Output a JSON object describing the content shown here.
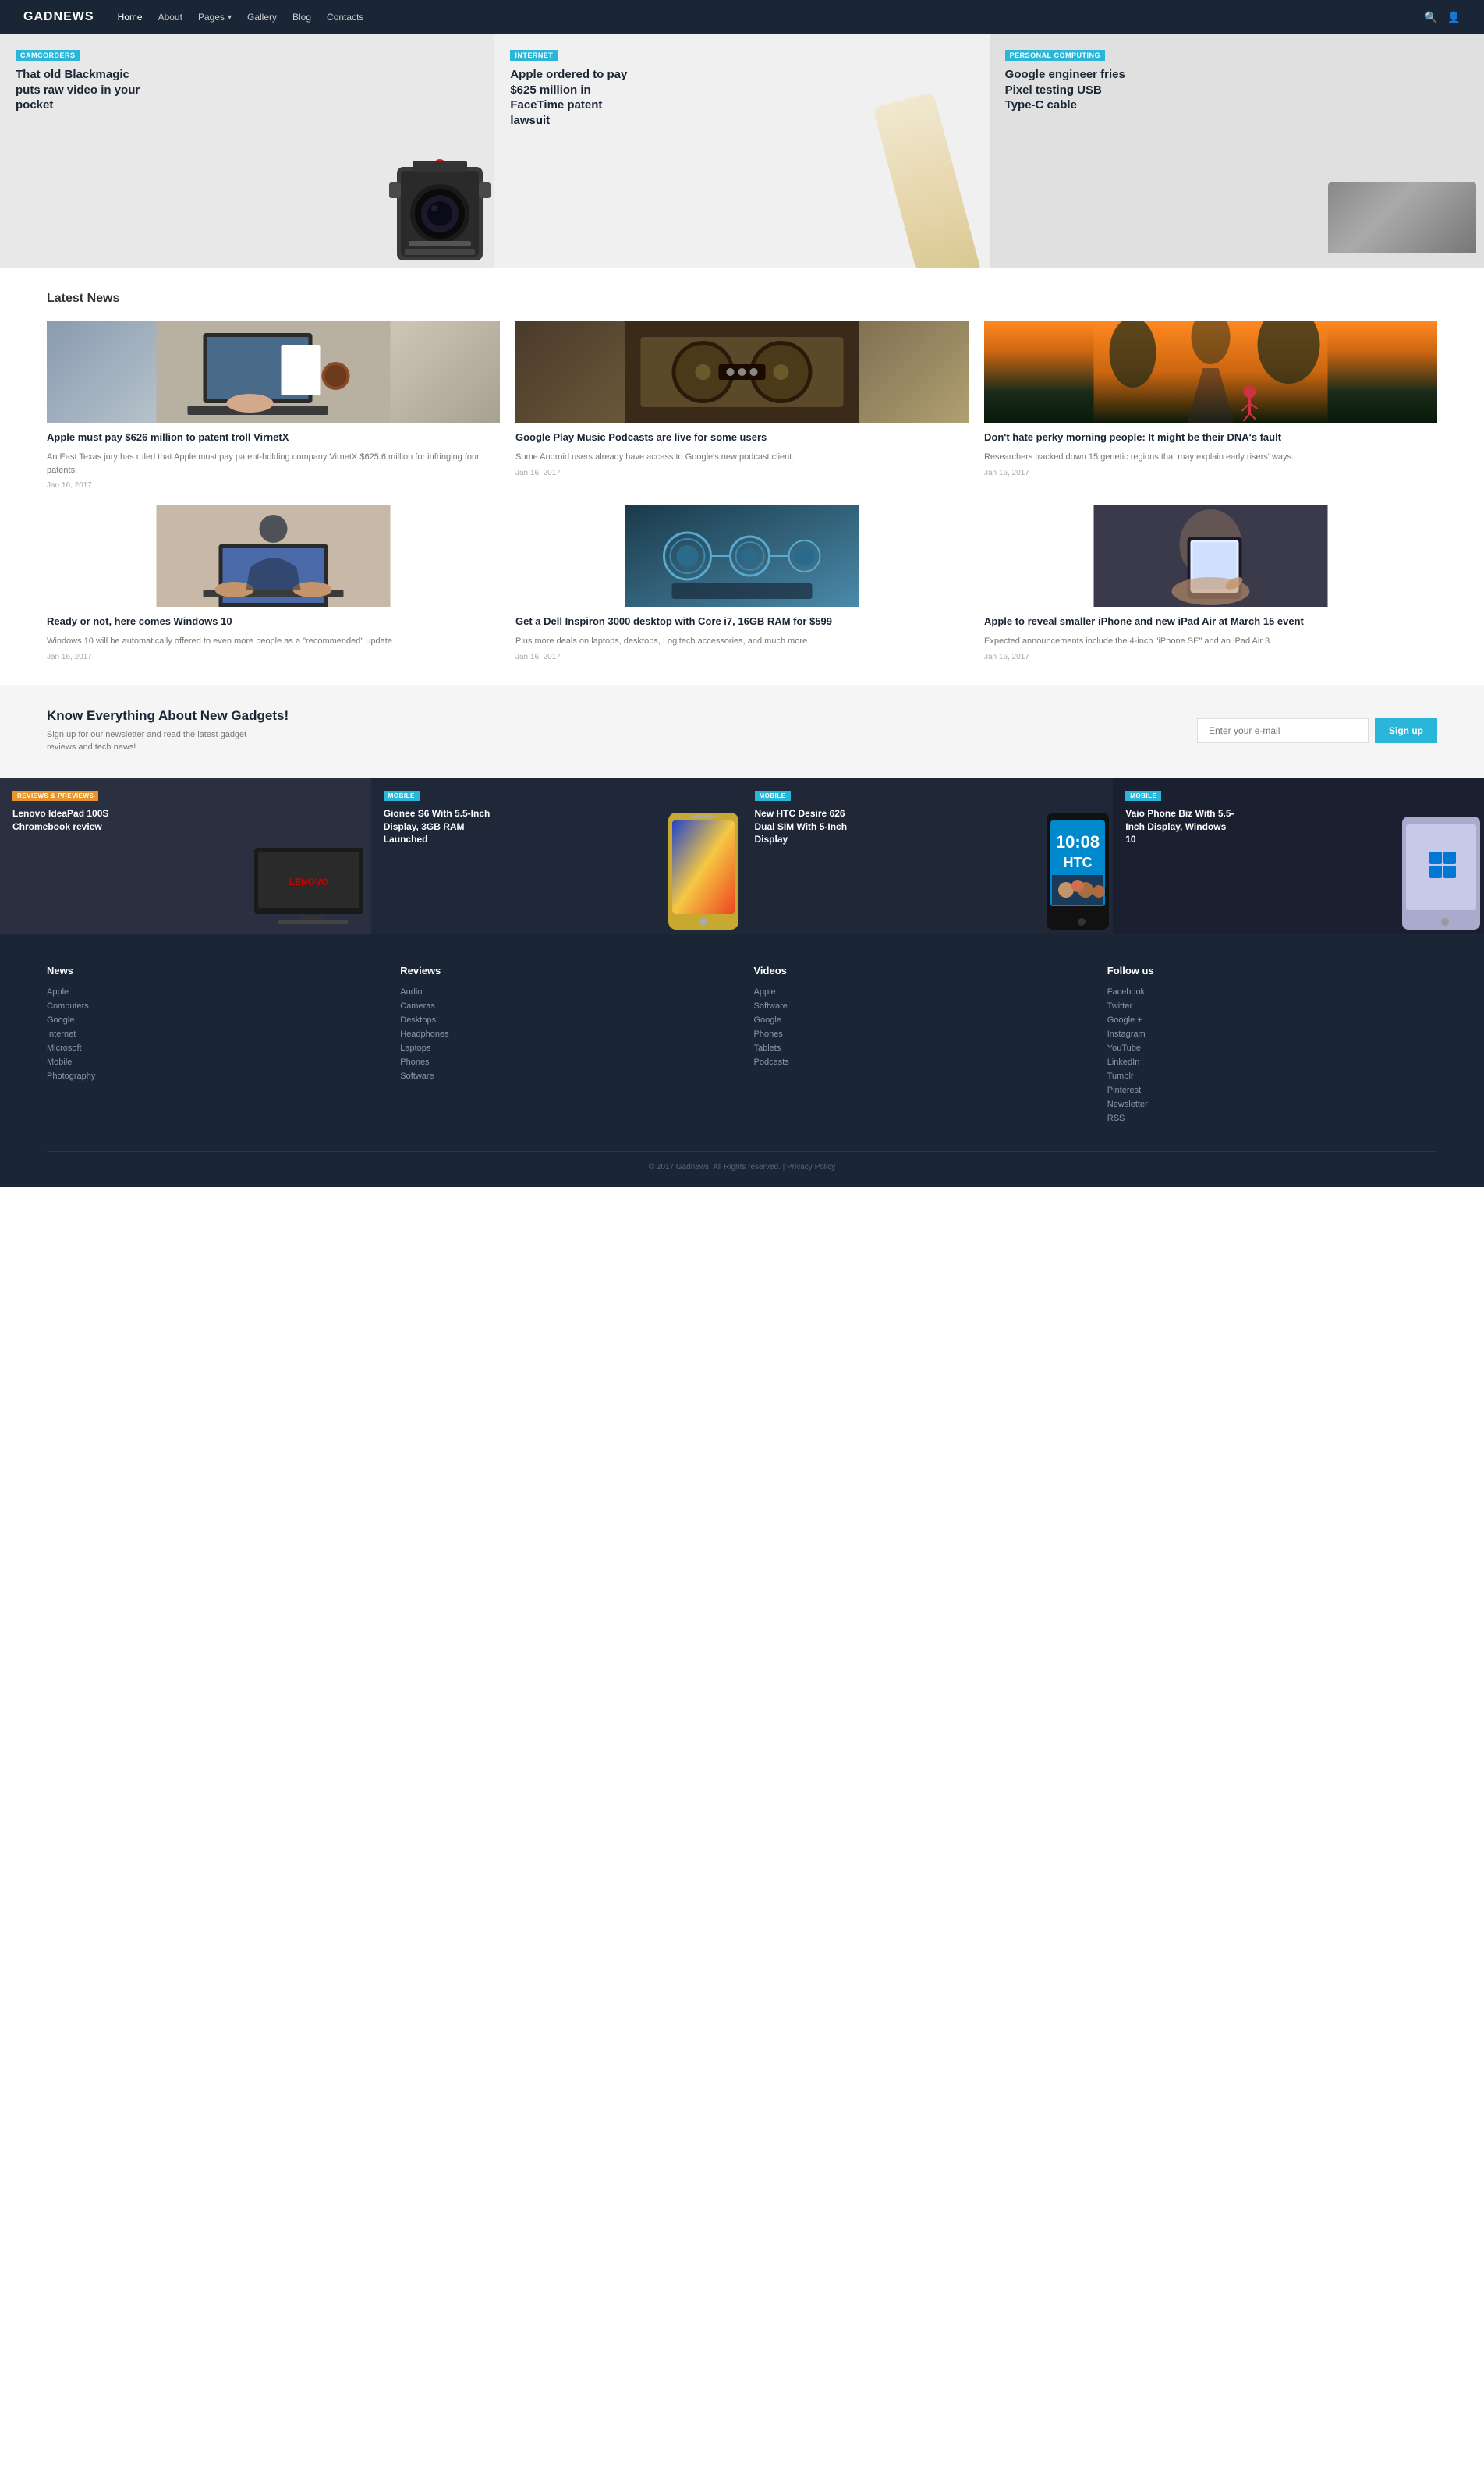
{
  "header": {
    "logo": "GADNEWS",
    "nav": [
      {
        "label": "Home",
        "active": true
      },
      {
        "label": "About"
      },
      {
        "label": "Pages",
        "hasDropdown": true
      },
      {
        "label": "Gallery"
      },
      {
        "label": "Blog"
      },
      {
        "label": "Contacts"
      }
    ]
  },
  "hero": {
    "items": [
      {
        "badge": "CAMCORDERS",
        "title": "That old Blackmagic puts raw video in your pocket"
      },
      {
        "badge": "INTERNET",
        "title": "Apple ordered to pay $625 million in FaceTime patent lawsuit"
      },
      {
        "badge": "PERSONAL COMPUTING",
        "title": "Google engineer fries Pixel testing USB Type-C cable"
      }
    ]
  },
  "latestNews": {
    "sectionTitle": "Latest News",
    "items": [
      {
        "title": "Apple must pay $626 million to patent troll VirnetX",
        "desc": "An East Texas jury has ruled that Apple must pay patent-holding company VirnetX $625.6 million for infringing four patents.",
        "date": "Jan 16, 2017",
        "imgClass": "img-laptop"
      },
      {
        "title": "Google Play Music Podcasts are live for some users",
        "desc": "Some Android users already have access to Google's new podcast client.",
        "date": "Jan 16, 2017",
        "imgClass": "img-reel"
      },
      {
        "title": "Don't hate perky morning people: It might be their DNA's fault",
        "desc": "Researchers tracked down 15 genetic regions that may explain early risers' ways.",
        "date": "Jan 16, 2017",
        "imgClass": "img-runner"
      },
      {
        "title": "Ready or not, here comes Windows 10",
        "desc": "Windows 10 will be automatically offered to even more people as a \"recommended\" update.",
        "date": "Jan 16, 2017",
        "imgClass": "img-hands"
      },
      {
        "title": "Get a Dell Inspiron 3000 desktop with Core i7, 16GB RAM for $599",
        "desc": "Plus more deals on laptops, desktops, Logitech accessories, and much more.",
        "date": "Jan 16, 2017",
        "imgClass": "img-circuit"
      },
      {
        "title": "Apple to reveal smaller iPhone and new iPad Air at March 15 event",
        "desc": "Expected announcements include the 4-inch \"iPhone SE\" and an iPad Air 3.",
        "date": "Jan 16, 2017",
        "imgClass": "img-iphone-hand"
      }
    ]
  },
  "newsletter": {
    "title": "Know Everything About New Gadgets!",
    "desc": "Sign up for our newsletter and read the latest gadget reviews and tech news!",
    "inputPlaceholder": "Enter your e-mail",
    "buttonLabel": "Sign up"
  },
  "featured": {
    "items": [
      {
        "badge": "REVIEWS & PREVIEWS",
        "badgeClass": "reviews",
        "title": "Lenovo IdeaPad 100S Chromebook review",
        "imgClass": "img-chromebook"
      },
      {
        "badge": "MOBILE",
        "badgeClass": "mobile",
        "title": "Gionee S6 With 5.5-Inch Display, 3GB RAM Launched",
        "imgClass": "img-phone-gold"
      },
      {
        "badge": "MOBILE",
        "badgeClass": "mobile",
        "title": "New HTC Desire 626 Dual SIM With 5-Inch Display",
        "imgClass": "img-htc"
      },
      {
        "badge": "MOBILE",
        "badgeClass": "mobile",
        "title": "Vaio Phone Biz With 5.5-Inch Display, Windows 10",
        "imgClass": "img-vaio"
      }
    ]
  },
  "footer": {
    "cols": [
      {
        "heading": "News",
        "links": [
          "Apple",
          "Computers",
          "Google",
          "Internet",
          "Microsoft",
          "Mobile",
          "Photography"
        ]
      },
      {
        "heading": "Reviews",
        "links": [
          "Audio",
          "Cameras",
          "Desktops",
          "Headphones",
          "Laptops",
          "Phones",
          "Software"
        ]
      },
      {
        "heading": "Videos",
        "links": [
          "Apple",
          "Software",
          "Google",
          "Phones",
          "Tablets",
          "Podcasts"
        ]
      },
      {
        "heading": "Follow us",
        "links": [
          "Facebook",
          "Twitter",
          "Google +",
          "Instagram",
          "YouTube",
          "LinkedIn",
          "Tumblr",
          "Pinterest",
          "Newsletter",
          "RSS"
        ]
      }
    ],
    "copyright": "© 2017 Gadnews. All Rights reserved. | Privacy Policy"
  }
}
